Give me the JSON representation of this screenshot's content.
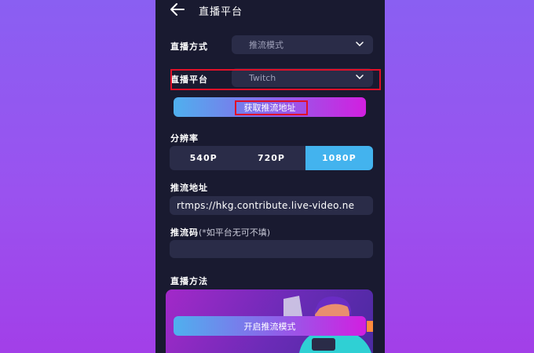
{
  "header": {
    "title": "直播平台"
  },
  "mode": {
    "label": "直播方式",
    "value": "推流模式"
  },
  "platform": {
    "label": "直播平台",
    "value": "Twitch"
  },
  "get_address_button": "获取推流地址",
  "resolution": {
    "label": "分辨率",
    "options": [
      "540P",
      "720P",
      "1080P"
    ],
    "selected": "1080P"
  },
  "stream_url": {
    "label": "推流地址",
    "value": "rtmps://hkg.contribute.live-video.ne"
  },
  "stream_key": {
    "label": "推流码",
    "note": "(*如平台无可不填)",
    "value": ""
  },
  "method": {
    "label": "直播方法"
  },
  "start_button": "开启推流模式",
  "colors": {
    "background": "#191a30",
    "field": "#2a2c48",
    "accent": "#43b3ee",
    "highlight": "#e01028"
  },
  "icons": [
    "back-arrow-icon",
    "chevron-down-icon"
  ]
}
